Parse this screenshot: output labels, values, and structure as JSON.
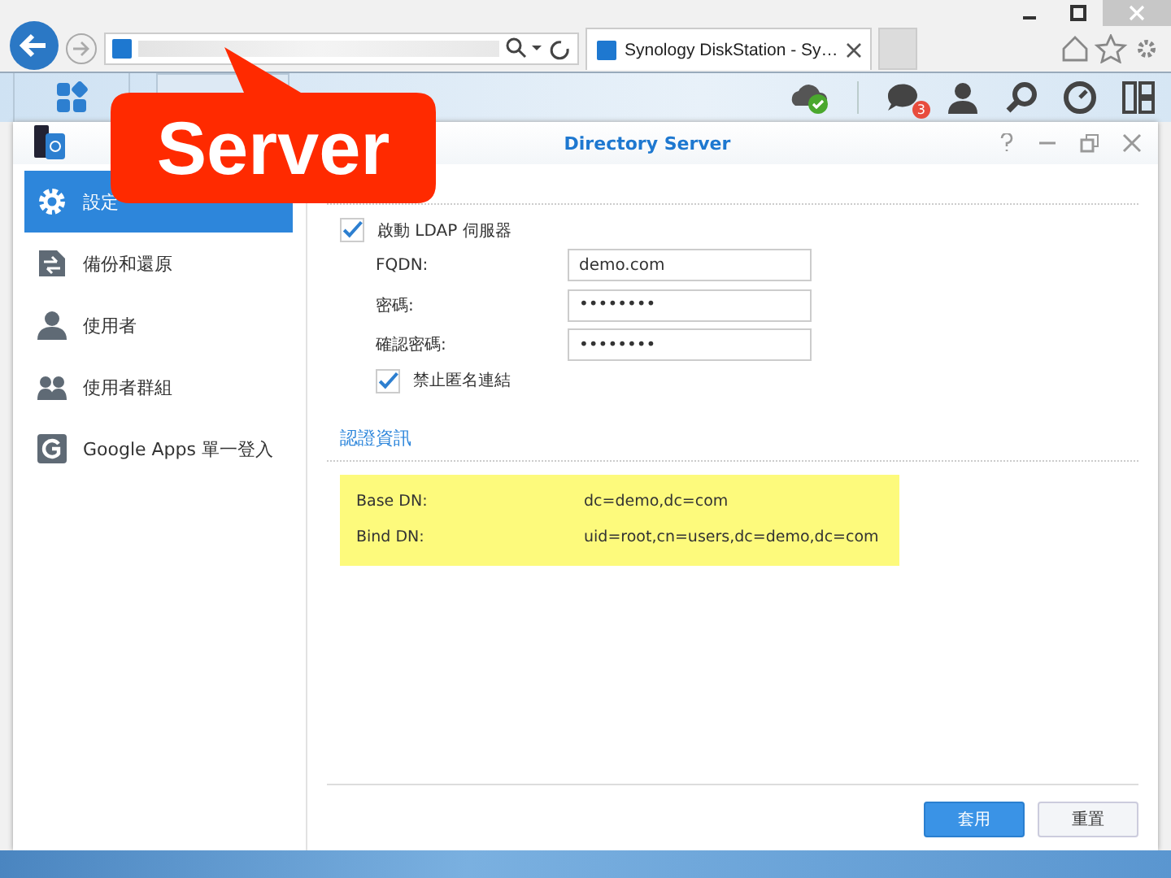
{
  "browser": {
    "tab_title": "Synology DiskStation - Sy…"
  },
  "taskbar": {
    "notification_count": "3"
  },
  "window": {
    "title": "Directory Server"
  },
  "sidebar": {
    "items": [
      {
        "label": "設定",
        "selected": true
      },
      {
        "label": "備份和還原",
        "selected": false
      },
      {
        "label": "使用者",
        "selected": false
      },
      {
        "label": "使用者群組",
        "selected": false
      },
      {
        "label": "Google Apps 單一登入",
        "selected": false
      }
    ]
  },
  "form": {
    "enable": {
      "label": "啟動 LDAP 伺服器",
      "checked": true
    },
    "fields": [
      {
        "label": "FQDN:",
        "value": "demo.com"
      },
      {
        "label": "密碼:",
        "value": "••••••••"
      },
      {
        "label": "確認密碼:",
        "value": "••••••••"
      }
    ],
    "anonymous": {
      "label": "禁止匿名連結",
      "checked": true
    }
  },
  "auth_info": {
    "title": "認證資訊",
    "rows": [
      {
        "label": "Base DN:",
        "value": "dc=demo,dc=com"
      },
      {
        "label": "Bind DN:",
        "value": "uid=root,cn=users,dc=demo,dc=com"
      }
    ]
  },
  "buttons": [
    {
      "label": "套用",
      "kind": "primary"
    },
    {
      "label": "重置",
      "kind": "secondary"
    }
  ],
  "callout": {
    "text": "Server"
  }
}
